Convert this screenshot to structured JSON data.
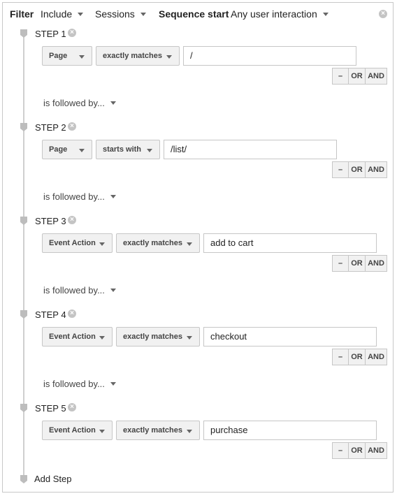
{
  "filter_bar": {
    "filter_label": "Filter",
    "include_value": "Include",
    "sessions_value": "Sessions",
    "sequence_start_label": "Sequence start",
    "sequence_start_value": "Any user interaction"
  },
  "remove_glyph": "×",
  "logic_buttons": {
    "minus": "–",
    "or": "OR",
    "and": "AND"
  },
  "followed_by_label": "is followed by...",
  "steps": [
    {
      "label": "STEP 1",
      "dimension": "Page",
      "match": "exactly matches",
      "value": "/"
    },
    {
      "label": "STEP 2",
      "dimension": "Page",
      "match": "starts with",
      "value": "/list/"
    },
    {
      "label": "STEP 3",
      "dimension": "Event Action",
      "match": "exactly matches",
      "value": "add to cart"
    },
    {
      "label": "STEP 4",
      "dimension": "Event Action",
      "match": "exactly matches",
      "value": "checkout"
    },
    {
      "label": "STEP 5",
      "dimension": "Event Action",
      "match": "exactly matches",
      "value": "purchase"
    }
  ],
  "add_step_label": "Add Step",
  "colors": {
    "line": "#cfcfcf",
    "marker": "#bdbdbd",
    "button_bg": "#f1f1f1",
    "border": "#c6c6c6"
  }
}
